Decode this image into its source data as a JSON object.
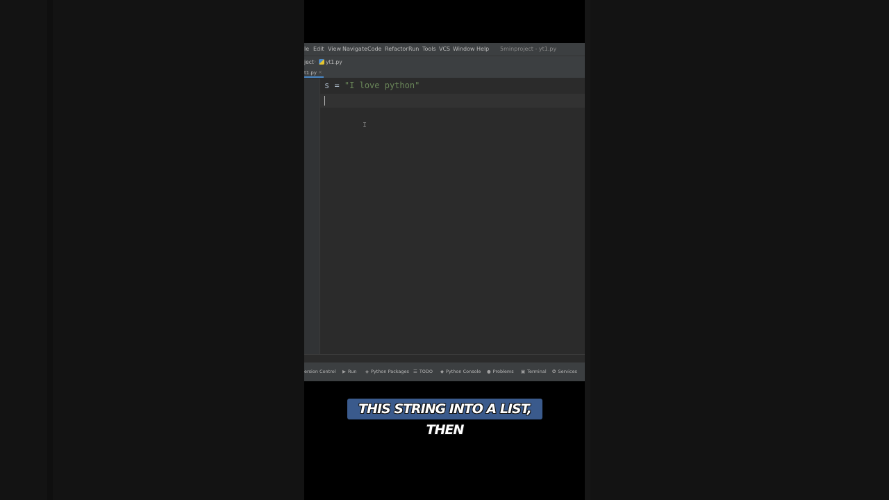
{
  "menu": {
    "items": [
      "le",
      "Edit",
      "View",
      "Navigate",
      "Code",
      "Refactor",
      "Run",
      "Tools",
      "VCS",
      "Window",
      "Help"
    ],
    "window_title": "5minproject - yt1.py"
  },
  "navbar": {
    "project_crumb": "ject",
    "file_crumb": "yt1.py"
  },
  "tabs": [
    {
      "label": "t1.py",
      "close": "×"
    }
  ],
  "editor": {
    "lines": [
      {
        "ident": "s",
        "op": " = ",
        "string": "\"I love python\""
      }
    ]
  },
  "toolwindows": [
    {
      "label": "ersion Control",
      "icon": ""
    },
    {
      "label": "Run",
      "icon": "▶"
    },
    {
      "label": "Python Packages",
      "icon": "◈"
    },
    {
      "label": "TODO",
      "icon": "☰"
    },
    {
      "label": "Python Console",
      "icon": "◆"
    },
    {
      "label": "Problems",
      "icon": "●"
    },
    {
      "label": "Terminal",
      "icon": "▣"
    },
    {
      "label": "Services",
      "icon": "✪"
    }
  ],
  "caption": {
    "text": "THIS STRING INTO A LIST, THEN"
  },
  "colors": {
    "accent": "#4a88c7",
    "string": "#6a8759",
    "caption_bg": "#3a5a8c"
  }
}
